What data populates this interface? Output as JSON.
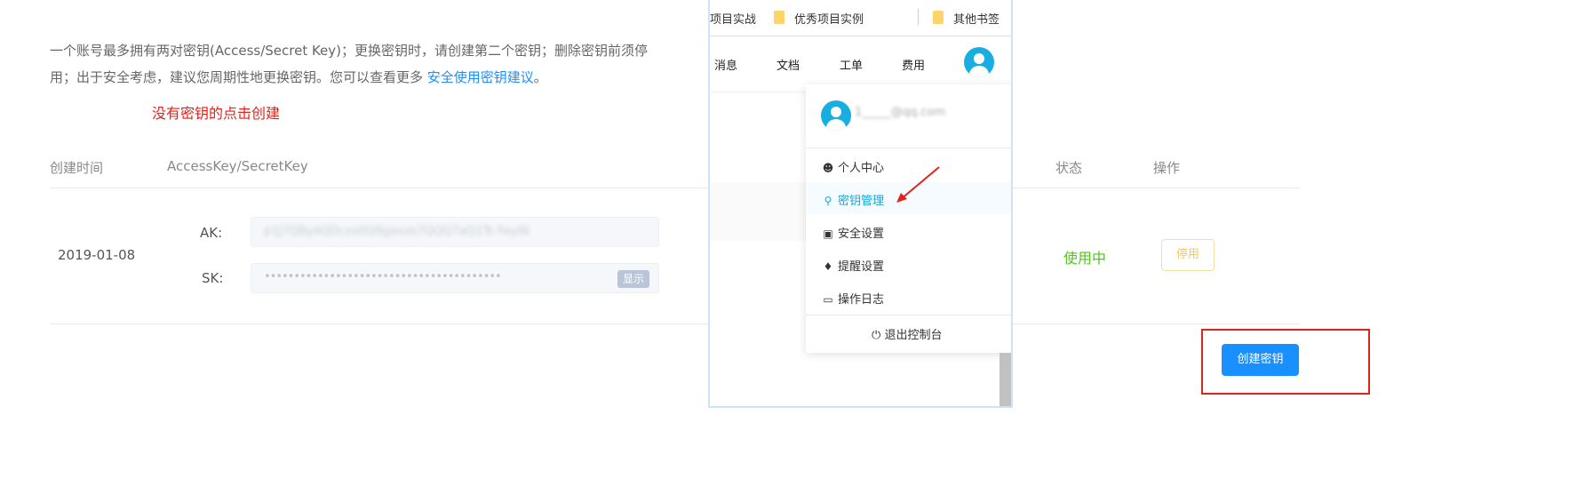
{
  "notice": {
    "text": "一个账号最多拥有两对密钥(Access/Secret Key)；更换密钥时，请创建第二个密钥；删除密钥前须停用；出于安全考虑，建议您周期性地更换密钥。您可以查看更多 ",
    "link": "安全使用密钥建议",
    "end": "。"
  },
  "hint": "没有密钥的点击创建",
  "table": {
    "headers": {
      "created": "创建时间",
      "keys": "AccessKey/SecretKey",
      "status": "状态",
      "actions": "操作"
    },
    "row": {
      "date": "2019-01-08",
      "ak_label": "AK:",
      "ak_value": "p1J7QBy4QDcxx0Q9gaxxk7QQQ7aQ1Ts FeyIN",
      "sk_label": "SK:",
      "sk_value": "••••••••••••••••••••••••••••••••••••••••",
      "show_label": "显示",
      "status": "使用中",
      "disable_label": "停用"
    }
  },
  "create_button": "创建密钥",
  "overlay": {
    "bookmarks": [
      {
        "label": "项目实战"
      },
      {
        "label": "优秀项目实例"
      },
      {
        "label": "其他书签"
      }
    ],
    "nav": [
      "消息",
      "文档",
      "工单",
      "费用"
    ],
    "menu": {
      "email": "1_____@qq.com",
      "items": [
        {
          "label": "个人中心",
          "icon": "user-icon"
        },
        {
          "label": "密钥管理",
          "icon": "key-icon"
        },
        {
          "label": "安全设置",
          "icon": "wallet-icon"
        },
        {
          "label": "提醒设置",
          "icon": "bell-icon"
        },
        {
          "label": "操作日志",
          "icon": "monitor-icon"
        }
      ],
      "logout": "退出控制台"
    }
  },
  "colors": {
    "link": "#1890ff",
    "hint": "#e2231a",
    "status_active": "#52c41a",
    "primary_button": "#1890ff",
    "highlight": "#d9261c",
    "active_menu": "#19a7d6"
  }
}
